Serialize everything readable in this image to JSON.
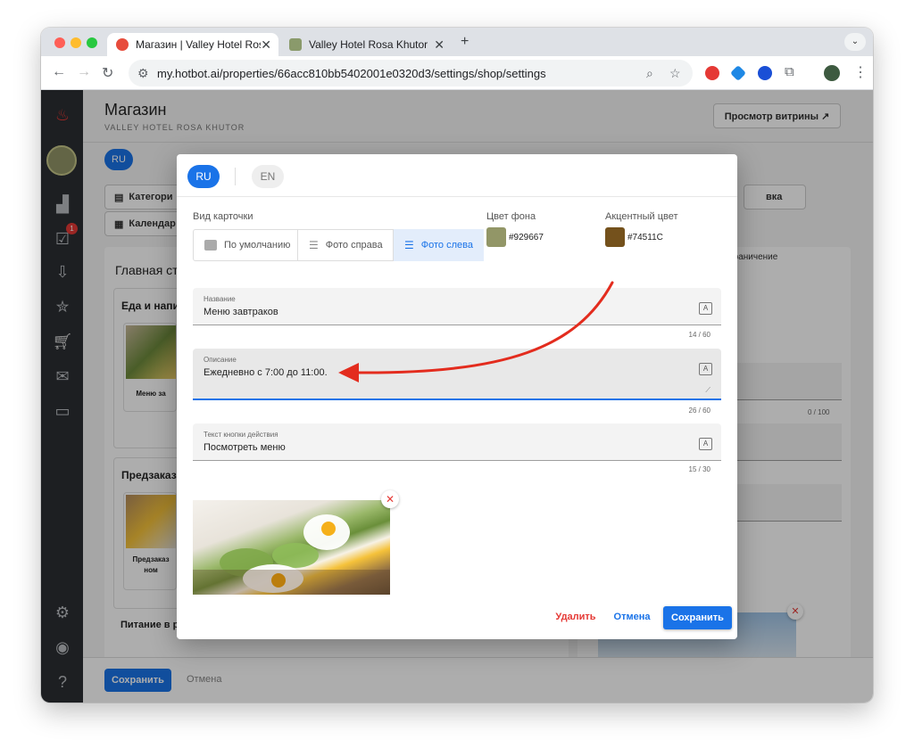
{
  "browser": {
    "tabs": [
      {
        "title": "Магазин | Valley Hotel Rosa Kh"
      },
      {
        "title": "Valley Hotel Rosa Khutor"
      }
    ],
    "new_tab": "+",
    "url": "my.hotbot.ai/properties/66acc810bb5402001e0320d3/settings/shop/settings"
  },
  "page": {
    "title": "Магазин",
    "subtitle": "VALLEY HOTEL ROSA KHUTOR",
    "storefront_button": "Просмотр витрины ↗",
    "lang_ru": "RU",
    "tab_categories": "Категори",
    "tab_calendar": "Календар",
    "tab_right": "вка",
    "section_main": "Главная ст",
    "card_food": "Еда и напит",
    "item_breakfast": "Меню за",
    "section_preorder": "Предзаказ",
    "item_preorder_line1": "Предзаказ",
    "item_preorder_line2": "ном",
    "section_restaurant": "Питание в ресторане",
    "right_chip": "ное ограничение",
    "right_counter": "0 / 100",
    "bottom_save": "Сохранить",
    "bottom_cancel": "Отмена",
    "sidebar_badge": "1"
  },
  "modal": {
    "lang_ru": "RU",
    "lang_en": "EN",
    "card_view_label": "Вид карточки",
    "card_view_options": [
      "По умолчанию",
      "Фото справа",
      "Фото слева"
    ],
    "bg_color_label": "Цвет фона",
    "bg_color_value": "#929667",
    "accent_color_label": "Акцентный цвет",
    "accent_color_value": "#74511C",
    "name_label": "Название",
    "name_value": "Меню завтраков",
    "name_counter": "14 / 60",
    "desc_label": "Описание",
    "desc_value": "Ежедневно с 7:00 до 11:00.",
    "desc_counter": "26 / 60",
    "button_text_label": "Текст кнопки действия",
    "button_text_value": "Посмотреть меню",
    "button_text_counter": "15 / 30",
    "delete_label": "Удалить",
    "cancel_label": "Отмена",
    "save_label": "Сохранить"
  },
  "colors": {
    "primary": "#1a73e8",
    "danger": "#e53935",
    "sidebar": "#2c2f33"
  }
}
